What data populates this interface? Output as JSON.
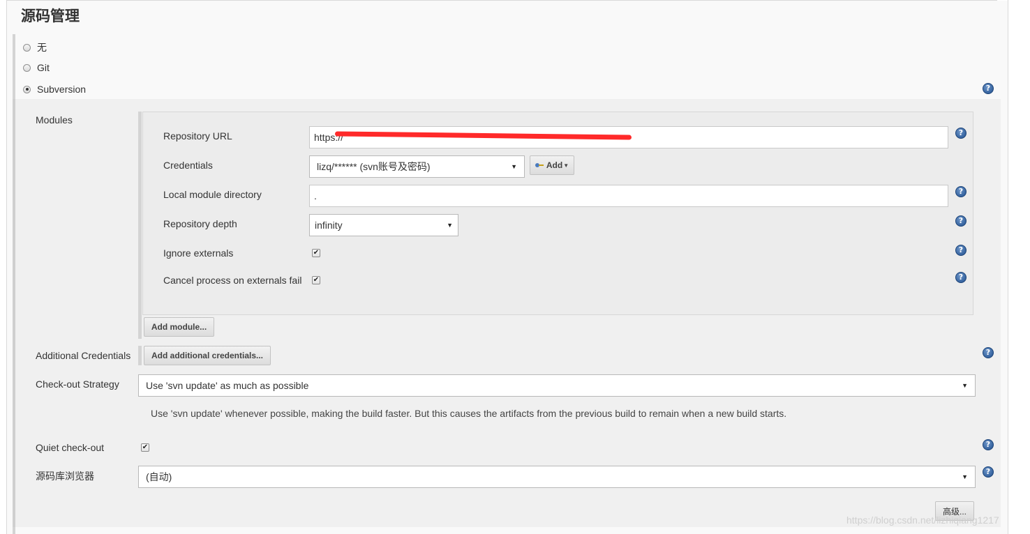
{
  "section": {
    "title": "源码管理"
  },
  "scm_options": [
    {
      "label": "无",
      "selected": false
    },
    {
      "label": "Git",
      "selected": false
    },
    {
      "label": "Subversion",
      "selected": true
    }
  ],
  "modules": {
    "label": "Modules",
    "repo_url": {
      "label": "Repository URL",
      "value": "https://"
    },
    "credentials": {
      "label": "Credentials",
      "value": "lizq/****** (svn账号及密码)",
      "add_label": "Add"
    },
    "local_dir": {
      "label": "Local module directory",
      "value": "."
    },
    "depth": {
      "label": "Repository depth",
      "value": "infinity"
    },
    "ignore_externals": {
      "label": "Ignore externals",
      "checked": true
    },
    "cancel_externals": {
      "label": "Cancel process on externals fail",
      "checked": true
    },
    "add_module_label": "Add module..."
  },
  "additional_credentials": {
    "label": "Additional Credentials",
    "button_label": "Add additional credentials..."
  },
  "checkout_strategy": {
    "label": "Check-out Strategy",
    "value": "Use 'svn update' as much as possible",
    "description": "Use 'svn update' whenever possible, making the build faster. But this causes the artifacts from the previous build to remain when a new build starts."
  },
  "quiet_checkout": {
    "label": "Quiet check-out",
    "checked": true
  },
  "repo_browser": {
    "label": "源码库浏览器",
    "value": "(自动)"
  },
  "advanced_label": "高级...",
  "help_glyph": "?",
  "check_glyph": "✔",
  "caret_glyph": "▼",
  "watermark": "https://blog.csdn.net/lizhiqiang1217",
  "colors": {
    "help_icon": "#2c5fa3",
    "redaction": "#ff2a2a"
  }
}
